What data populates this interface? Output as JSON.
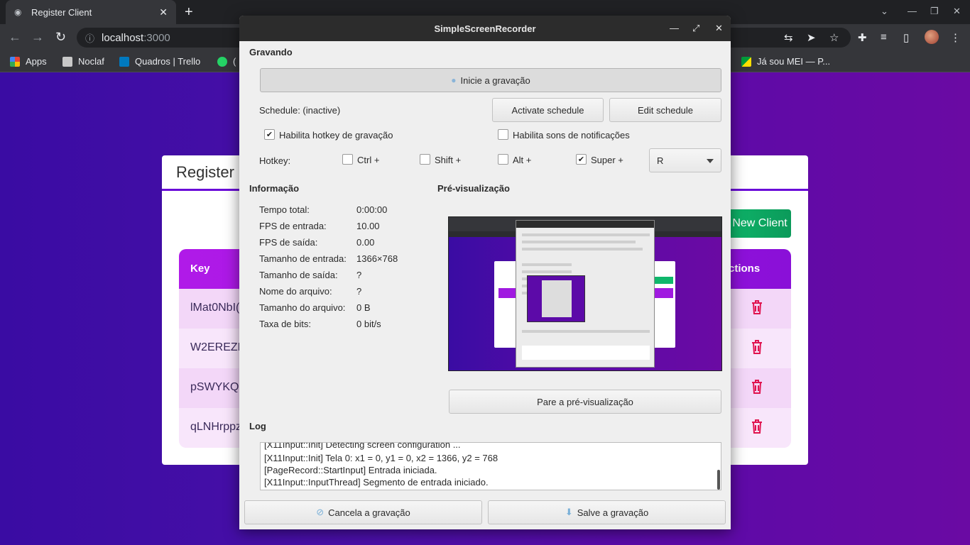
{
  "browser": {
    "tab_title": "Register Client",
    "url_host": "localhost",
    "url_port": ":3000",
    "bookmarks": [
      "Apps",
      "Noclaf",
      "Quadros | Trello",
      "(",
      "Já sou MEI — P..."
    ]
  },
  "webpage": {
    "card_title": "Register",
    "new_client_label": "New Client",
    "col_key": "Key",
    "col_actions": "ctions",
    "rows": [
      "lMat0NbI(",
      "W2EREZH",
      "pSWYKQk",
      "qLNHrppz"
    ]
  },
  "ssr": {
    "window_title": "SimpleScreenRecorder",
    "section_recording": "Gravando",
    "start_recording": "Inicie a gravação",
    "schedule_label": "Schedule: (inactive)",
    "activate_schedule": "Activate schedule",
    "edit_schedule": "Edit schedule",
    "enable_hotkey": "Habilita hotkey de gravação",
    "enable_sounds": "Habilita sons de notificações",
    "hotkey_label": "Hotkey:",
    "mod_ctrl": "Ctrl +",
    "mod_shift": "Shift +",
    "mod_alt": "Alt +",
    "mod_super": "Super +",
    "hotkey_key": "R",
    "section_info": "Informação",
    "section_preview": "Pré-visualização",
    "info": [
      {
        "label": "Tempo total:",
        "value": "0:00:00"
      },
      {
        "label": "FPS de entrada:",
        "value": "10.00"
      },
      {
        "label": "FPS de saída:",
        "value": "0.00"
      },
      {
        "label": "Tamanho de entrada:",
        "value": "1366×768"
      },
      {
        "label": "Tamanho de saída:",
        "value": "?"
      },
      {
        "label": "Nome do arquivo:",
        "value": "?"
      },
      {
        "label": "Tamanho do arquivo:",
        "value": "0 B"
      },
      {
        "label": "Taxa de bits:",
        "value": "0 bit/s"
      }
    ],
    "stop_preview": "Pare a pré-visualização",
    "section_log": "Log",
    "log_lines": [
      "[X11Input::Init] Detecting screen configuration ...",
      "[X11Input::Init] Tela 0: x1 = 0, y1 = 0, x2 = 1366, y2 = 768",
      "[PageRecord::StartInput] Entrada iniciada.",
      "[X11Input::InputThread] Segmento de entrada iniciado."
    ],
    "cancel_recording": "Cancela a gravação",
    "save_recording": "Salve a gravação"
  }
}
